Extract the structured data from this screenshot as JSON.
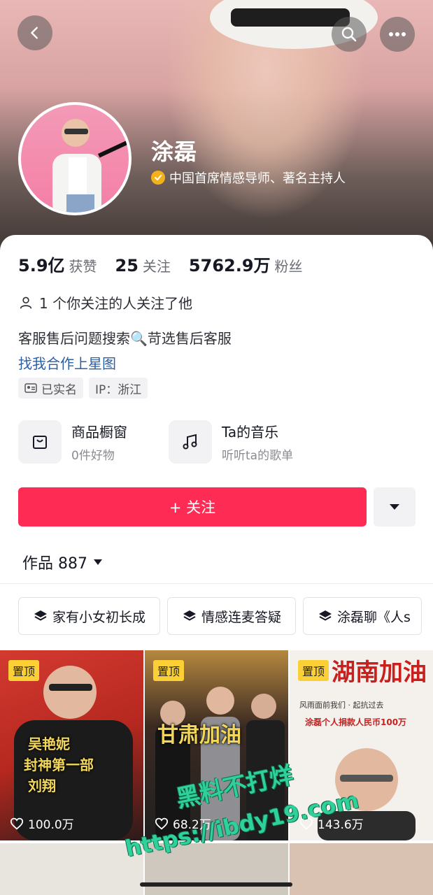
{
  "profile": {
    "name": "涂磊",
    "verification": "中国首席情感导师、著名主持人",
    "stats": [
      {
        "value": "5.9亿",
        "label": "获赞"
      },
      {
        "value": "25",
        "label": "关注"
      },
      {
        "value": "5762.9万",
        "label": "粉丝"
      }
    ],
    "mutual": "1 个你关注的人关注了他",
    "bio": "客服售后问题搜索🔍苛选售后客服",
    "link": "找我合作上星图",
    "tags": [
      "已实名",
      "IP：浙江"
    ]
  },
  "features": [
    {
      "title": "商品橱窗",
      "subtitle": "0件好物",
      "icon": "shopping-bag-icon"
    },
    {
      "title": "Ta的音乐",
      "subtitle": "听听ta的歌单",
      "icon": "music-note-icon"
    }
  ],
  "actions": {
    "follow_label": "+ 关注"
  },
  "works": {
    "label": "作品 887"
  },
  "collections": [
    "家有小女初长成",
    "情感连麦答疑",
    "涂磊聊《人s"
  ],
  "videos": [
    {
      "pin": "置顶",
      "likes": "100.0万",
      "overlay": [
        "吴艳妮",
        "封神第一部",
        "刘翔"
      ]
    },
    {
      "pin": "置顶",
      "likes": "68.2万",
      "overlay": [
        "甘肃加油"
      ]
    },
    {
      "pin": "置顶",
      "likes": "143.6万",
      "overlay": [
        "湖南加油",
        "风雨面前我们 · 起抗过去",
        "涂磊个人捐款人民币100万"
      ]
    }
  ],
  "watermark": {
    "line1": "黑料不打烊",
    "line2": "https://ibdy19.com"
  },
  "colors": {
    "accent": "#fe2c55",
    "link": "#2d5fa3",
    "verify": "#f3b21c",
    "pin": "#fad036"
  }
}
